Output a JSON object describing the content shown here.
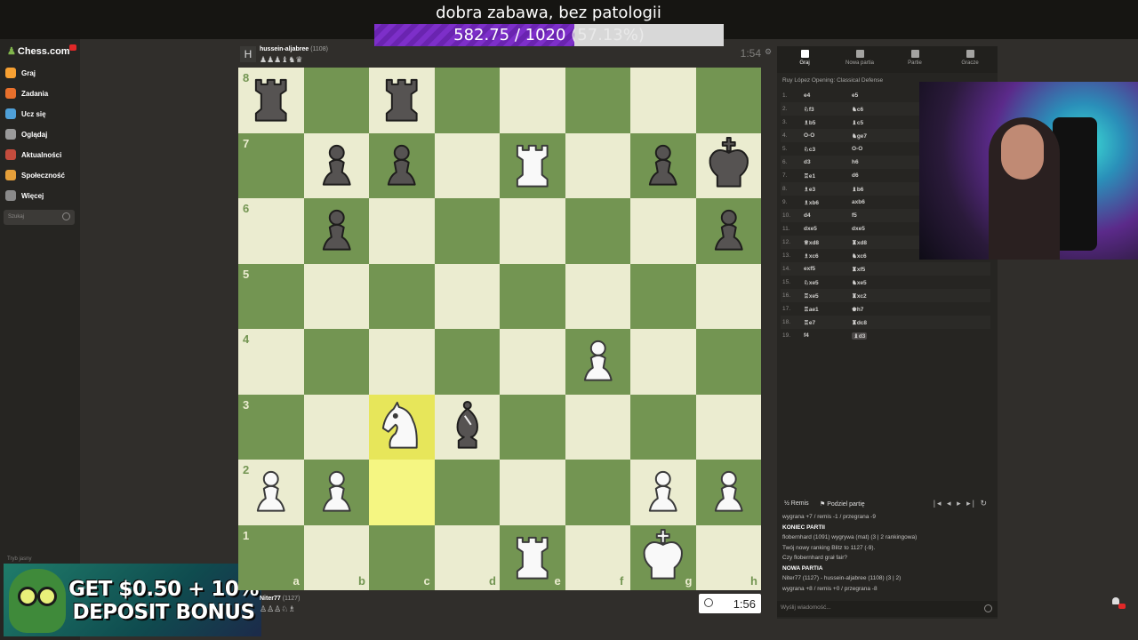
{
  "stream": {
    "title": "dobra zabawa, bez patologii",
    "goal_current": "582.75 / 1020",
    "goal_percent_text": "(57.13%)",
    "goal_fraction": 0.5713
  },
  "sidebar": {
    "logo": "Chess.com",
    "items": [
      {
        "label": "Graj",
        "color": "#f7a032"
      },
      {
        "label": "Zadania",
        "color": "#e8702c"
      },
      {
        "label": "Ucz się",
        "color": "#4fa0d8"
      },
      {
        "label": "Oglądaj",
        "color": "#9a9a9a"
      },
      {
        "label": "Aktualności",
        "color": "#c44c3d"
      },
      {
        "label": "Społeczność",
        "color": "#e6a03a"
      },
      {
        "label": "Więcej",
        "color": "#8a8a8a"
      }
    ],
    "search_placeholder": "Szukaj",
    "mode_label": "Tryb jasny"
  },
  "ad": {
    "line1": "GET $0.50 + 10%",
    "line2": "DEPOSIT BONUS"
  },
  "opponent": {
    "name": "hussein-aljabree",
    "rating": "(1108)",
    "captured": "♟♟♟♝♞♛",
    "clock": "1:54"
  },
  "me": {
    "name": "Niter77",
    "rating": "(1127)",
    "captured": "♙♙♙♘♗",
    "clock": "1:56"
  },
  "board": {
    "ranks": [
      "8",
      "7",
      "6",
      "5",
      "4",
      "3",
      "2",
      "1"
    ],
    "files": [
      "a",
      "b",
      "c",
      "d",
      "e",
      "f",
      "g",
      "h"
    ],
    "highlights": [
      "c3",
      "c2"
    ],
    "pieces": [
      {
        "sq": "a8",
        "p": "r",
        "c": "b"
      },
      {
        "sq": "c8",
        "p": "r",
        "c": "b"
      },
      {
        "sq": "b7",
        "p": "p",
        "c": "b"
      },
      {
        "sq": "c7",
        "p": "p",
        "c": "b"
      },
      {
        "sq": "e7",
        "p": "r",
        "c": "w"
      },
      {
        "sq": "g7",
        "p": "p",
        "c": "b"
      },
      {
        "sq": "h7",
        "p": "k",
        "c": "b"
      },
      {
        "sq": "b6",
        "p": "p",
        "c": "b"
      },
      {
        "sq": "h6",
        "p": "p",
        "c": "b"
      },
      {
        "sq": "f4",
        "p": "p",
        "c": "w"
      },
      {
        "sq": "c3",
        "p": "n",
        "c": "w"
      },
      {
        "sq": "d3",
        "p": "b",
        "c": "b"
      },
      {
        "sq": "a2",
        "p": "p",
        "c": "w"
      },
      {
        "sq": "b2",
        "p": "p",
        "c": "w"
      },
      {
        "sq": "g2",
        "p": "p",
        "c": "w"
      },
      {
        "sq": "h2",
        "p": "p",
        "c": "w"
      },
      {
        "sq": "e1",
        "p": "r",
        "c": "w"
      },
      {
        "sq": "g1",
        "p": "k",
        "c": "w"
      }
    ]
  },
  "right_panel": {
    "tabs": [
      "Graj",
      "Nowa partia",
      "Partie",
      "Gracze"
    ],
    "opening": "Ruy López Opening: Classical Defense",
    "moves": [
      {
        "n": "1.",
        "w": "e4",
        "b": "e5"
      },
      {
        "n": "2.",
        "w": "♘f3",
        "b": "♞c6"
      },
      {
        "n": "3.",
        "w": "♗b5",
        "b": "♝c5"
      },
      {
        "n": "4.",
        "w": "O-O",
        "b": "♞ge7"
      },
      {
        "n": "5.",
        "w": "♘c3",
        "b": "O-O"
      },
      {
        "n": "6.",
        "w": "d3",
        "b": "h6"
      },
      {
        "n": "7.",
        "w": "♖e1",
        "b": "d6"
      },
      {
        "n": "8.",
        "w": "♗e3",
        "b": "♝b6"
      },
      {
        "n": "9.",
        "w": "♗xb6",
        "b": "axb6"
      },
      {
        "n": "10.",
        "w": "d4",
        "b": "f5"
      },
      {
        "n": "11.",
        "w": "dxe5",
        "b": "dxe5"
      },
      {
        "n": "12.",
        "w": "♕xd8",
        "b": "♜xd8"
      },
      {
        "n": "13.",
        "w": "♗xc6",
        "b": "♞xc6"
      },
      {
        "n": "14.",
        "w": "exf5",
        "b": "♜xf5"
      },
      {
        "n": "15.",
        "w": "♘xe5",
        "b": "♞xe5"
      },
      {
        "n": "16.",
        "w": "♖xe5",
        "b": "♜xc2"
      },
      {
        "n": "17.",
        "w": "♖ae1",
        "b": "♚h7"
      },
      {
        "n": "18.",
        "w": "♖e7",
        "b": "♜dc8"
      },
      {
        "n": "19.",
        "w": "f4",
        "b": "♝d3"
      }
    ],
    "actions": {
      "draw": "Remis",
      "share": "Podziel partię"
    },
    "chat": [
      {
        "t": "wygrana +7 / remis -1 / przegrana -9",
        "b": false
      },
      {
        "t": "KONIEC PARTII",
        "b": true
      },
      {
        "t": "flobernhard (1091) wygrywa (mat) (3 | 2 rankingowa)",
        "b": false
      },
      {
        "t": "Twój nowy ranking Blitz to 1127 (-9).",
        "b": false
      },
      {
        "t": "Czy flobernhard grał fair?",
        "b": false
      },
      {
        "t": "NOWA PARTIA",
        "b": true
      },
      {
        "t": "Niter77 (1127) - hussein-aljabree (1108) (3 | 2)",
        "b": false
      },
      {
        "t": "wygrana +8 / remis +0 / przegrana -8",
        "b": false
      }
    ],
    "chat_placeholder": "Wyślij wiadomość..."
  }
}
